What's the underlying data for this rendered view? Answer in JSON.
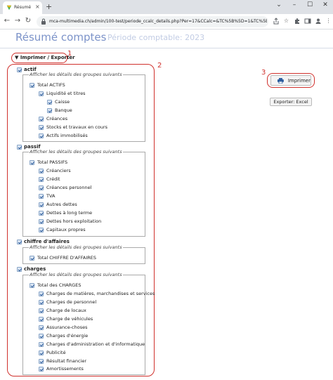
{
  "browser": {
    "tab_title": "Résumé co",
    "tab_close": "×",
    "new_tab": "+",
    "url": "mca-multimedia.ch/admin/100-test/periode_ccalc_details.php?Per=17&CCalc=&TC%5B%5D=1&TC%5B%5D...",
    "window_controls": [
      "⌄",
      "–",
      "☐",
      "✕"
    ]
  },
  "header": {
    "title": "Résumé comptes",
    "period": "Période comptable: 2023"
  },
  "annotations": [
    "1",
    "2",
    "3"
  ],
  "print_export": "▼ Imprimer / Exporter",
  "legend_text": "Afficher les détails des groupes suivants",
  "sections": {
    "actif": {
      "label": "actif",
      "items": [
        "Total ACTIFS",
        "Liquidité et titres",
        "Caisse",
        "Banque",
        "Créances",
        "Stocks et travaux en cours",
        "Actifs immobilisés"
      ]
    },
    "passif": {
      "label": "passif",
      "items": [
        "Total PASSIFS",
        "Créanciers",
        "Crédit",
        "Créances personnel",
        "TVA",
        "Autres dettes",
        "Dettes à long terme",
        "Dettes hors exploitation",
        "Capitaux propres"
      ]
    },
    "ca": {
      "label": "chiffre d'affaires",
      "items": [
        "Total CHIFFRE D'AFFAIRES"
      ]
    },
    "charges": {
      "label": "charges",
      "items": [
        "Total des CHARGES",
        "Charges de matières, marchandises et services",
        "Charges de personnel",
        "Charge de locaux",
        "Charge de véhicules",
        "Assurance-choses",
        "Charges d'énergie",
        "Charges d'administration et d'informatique",
        "Publicité",
        "Résultat financier",
        "Amortissements"
      ]
    }
  },
  "buttons": {
    "print": "Imprimer",
    "excel": "Exporter: Excel"
  },
  "colors": {
    "title": "#7c93c9",
    "annotation": "#d0312d"
  }
}
